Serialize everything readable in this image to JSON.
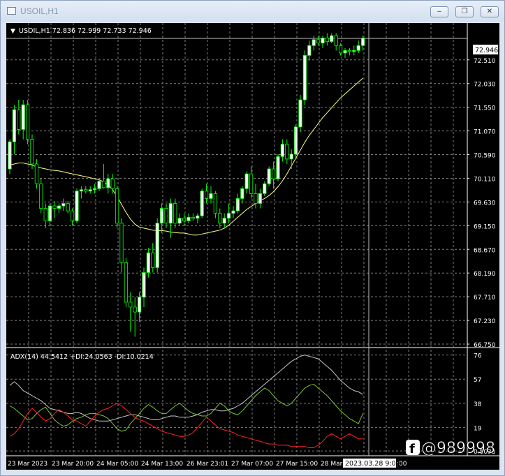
{
  "window": {
    "title": "USOIL,H1",
    "minimize_glyph": "‒",
    "restore_glyph": "❐",
    "close_glyph": "✕"
  },
  "chart_header": {
    "marker": "▼",
    "text": "USOIL,H1  72.836 72.999 72.733 72.946"
  },
  "indicator_header": {
    "text": "ADX(14) 44.5412 +DI:24.0563 -DI:10.0214"
  },
  "current_price": "72.946",
  "time_marker": "2023.03.28 9:00",
  "watermark": "@989998",
  "colors": {
    "background": "#000000",
    "grid": "#7f7f7f",
    "bull_candle": "#ffffff",
    "bear_candle": "#000000",
    "wick": "#00ff00",
    "moving_average": "#ffff80",
    "adx_line": "#c8c8c8",
    "plus_di": "#7cc832",
    "minus_di": "#ff2020",
    "axis_text": "#ffffff"
  },
  "chart_data": [
    {
      "type": "candlestick",
      "y_ticks": [
        "72.510",
        "72.030",
        "71.550",
        "71.070",
        "70.590",
        "70.110",
        "69.630",
        "69.150",
        "68.670",
        "68.190",
        "67.710",
        "67.230",
        "66.750"
      ],
      "x_ticks": [
        "23 Mar 2023",
        "23 Mar 20:00",
        "24 Mar 05:00",
        "24 Mar 13:00",
        "26 Mar 23:01",
        "27 Mar 07:00",
        "27 Mar 15:00",
        "28 Mar",
        "2023.03.28 9:00"
      ],
      "ylim": [
        66.75,
        73.2
      ],
      "candles": [
        {
          "o": 70.3,
          "h": 70.9,
          "l": 70.2,
          "c": 70.85
        },
        {
          "o": 70.85,
          "h": 71.6,
          "l": 70.6,
          "c": 71.5
        },
        {
          "o": 71.5,
          "h": 71.7,
          "l": 71.0,
          "c": 71.1
        },
        {
          "o": 71.1,
          "h": 71.7,
          "l": 70.9,
          "c": 71.6
        },
        {
          "o": 71.6,
          "h": 71.7,
          "l": 70.8,
          "c": 70.9
        },
        {
          "o": 70.9,
          "h": 71.0,
          "l": 70.3,
          "c": 70.4
        },
        {
          "o": 70.4,
          "h": 70.5,
          "l": 69.9,
          "c": 70.0
        },
        {
          "o": 70.0,
          "h": 70.1,
          "l": 69.4,
          "c": 69.5
        },
        {
          "o": 69.5,
          "h": 69.6,
          "l": 69.1,
          "c": 69.25
        },
        {
          "o": 69.25,
          "h": 69.6,
          "l": 69.15,
          "c": 69.55
        },
        {
          "o": 69.55,
          "h": 69.65,
          "l": 69.3,
          "c": 69.5
        },
        {
          "o": 69.5,
          "h": 69.6,
          "l": 69.4,
          "c": 69.55
        },
        {
          "o": 69.55,
          "h": 69.7,
          "l": 69.45,
          "c": 69.6
        },
        {
          "o": 69.6,
          "h": 69.65,
          "l": 69.4,
          "c": 69.45
        },
        {
          "o": 69.45,
          "h": 69.5,
          "l": 69.15,
          "c": 69.25
        },
        {
          "o": 69.25,
          "h": 69.9,
          "l": 69.2,
          "c": 69.85
        },
        {
          "o": 69.85,
          "h": 69.95,
          "l": 69.7,
          "c": 69.88
        },
        {
          "o": 69.88,
          "h": 69.95,
          "l": 69.8,
          "c": 69.85
        },
        {
          "o": 69.85,
          "h": 69.95,
          "l": 69.8,
          "c": 69.88
        },
        {
          "o": 69.88,
          "h": 70.0,
          "l": 69.8,
          "c": 69.9
        },
        {
          "o": 69.9,
          "h": 70.1,
          "l": 69.85,
          "c": 70.05
        },
        {
          "o": 70.05,
          "h": 70.4,
          "l": 69.9,
          "c": 69.92
        },
        {
          "o": 69.92,
          "h": 70.2,
          "l": 69.8,
          "c": 70.1
        },
        {
          "o": 70.1,
          "h": 70.2,
          "l": 69.8,
          "c": 69.9
        },
        {
          "o": 69.9,
          "h": 69.95,
          "l": 69.1,
          "c": 69.2
        },
        {
          "o": 69.2,
          "h": 69.3,
          "l": 68.2,
          "c": 68.4
        },
        {
          "o": 68.4,
          "h": 68.5,
          "l": 67.5,
          "c": 67.6
        },
        {
          "o": 67.6,
          "h": 67.8,
          "l": 67.0,
          "c": 67.5
        },
        {
          "o": 67.5,
          "h": 67.7,
          "l": 66.9,
          "c": 67.4
        },
        {
          "o": 67.4,
          "h": 67.8,
          "l": 67.2,
          "c": 67.7
        },
        {
          "o": 67.7,
          "h": 68.3,
          "l": 67.5,
          "c": 68.2
        },
        {
          "o": 68.2,
          "h": 68.7,
          "l": 68.1,
          "c": 68.6
        },
        {
          "o": 68.6,
          "h": 68.8,
          "l": 68.2,
          "c": 68.3
        },
        {
          "o": 68.3,
          "h": 69.3,
          "l": 68.2,
          "c": 69.2
        },
        {
          "o": 69.2,
          "h": 69.6,
          "l": 69.0,
          "c": 69.5
        },
        {
          "o": 69.5,
          "h": 69.6,
          "l": 69.1,
          "c": 69.2
        },
        {
          "o": 69.2,
          "h": 69.7,
          "l": 68.9,
          "c": 69.6
        },
        {
          "o": 69.6,
          "h": 69.7,
          "l": 69.1,
          "c": 69.2
        },
        {
          "o": 69.2,
          "h": 69.4,
          "l": 69.15,
          "c": 69.3
        },
        {
          "o": 69.3,
          "h": 69.4,
          "l": 69.15,
          "c": 69.25
        },
        {
          "o": 69.25,
          "h": 69.4,
          "l": 69.2,
          "c": 69.32
        },
        {
          "o": 69.32,
          "h": 69.4,
          "l": 69.25,
          "c": 69.3
        },
        {
          "o": 69.3,
          "h": 69.4,
          "l": 69.2,
          "c": 69.35
        },
        {
          "o": 69.35,
          "h": 69.9,
          "l": 69.3,
          "c": 69.85
        },
        {
          "o": 69.85,
          "h": 70.0,
          "l": 69.6,
          "c": 69.7
        },
        {
          "o": 69.7,
          "h": 69.95,
          "l": 69.6,
          "c": 69.8
        },
        {
          "o": 69.8,
          "h": 69.85,
          "l": 69.3,
          "c": 69.4
        },
        {
          "o": 69.4,
          "h": 69.5,
          "l": 69.1,
          "c": 69.2
        },
        {
          "o": 69.2,
          "h": 69.4,
          "l": 69.1,
          "c": 69.3
        },
        {
          "o": 69.3,
          "h": 69.6,
          "l": 69.2,
          "c": 69.4
        },
        {
          "o": 69.4,
          "h": 69.55,
          "l": 69.3,
          "c": 69.45
        },
        {
          "o": 69.45,
          "h": 69.8,
          "l": 69.4,
          "c": 69.7
        },
        {
          "o": 69.7,
          "h": 69.95,
          "l": 69.6,
          "c": 69.9
        },
        {
          "o": 69.9,
          "h": 70.25,
          "l": 69.8,
          "c": 70.2
        },
        {
          "o": 70.2,
          "h": 70.35,
          "l": 69.7,
          "c": 69.8
        },
        {
          "o": 69.8,
          "h": 70.0,
          "l": 69.5,
          "c": 69.6
        },
        {
          "o": 69.6,
          "h": 69.9,
          "l": 69.5,
          "c": 69.8
        },
        {
          "o": 69.8,
          "h": 70.05,
          "l": 69.75,
          "c": 70.0
        },
        {
          "o": 70.0,
          "h": 70.35,
          "l": 69.95,
          "c": 70.3
        },
        {
          "o": 70.3,
          "h": 70.45,
          "l": 69.9,
          "c": 70.1
        },
        {
          "o": 70.1,
          "h": 70.6,
          "l": 70.05,
          "c": 70.55
        },
        {
          "o": 70.55,
          "h": 70.9,
          "l": 70.45,
          "c": 70.8
        },
        {
          "o": 70.8,
          "h": 70.9,
          "l": 70.4,
          "c": 70.5
        },
        {
          "o": 70.5,
          "h": 70.7,
          "l": 70.3,
          "c": 70.6
        },
        {
          "o": 70.6,
          "h": 71.2,
          "l": 70.5,
          "c": 71.15
        },
        {
          "o": 71.15,
          "h": 71.8,
          "l": 71.05,
          "c": 71.7
        },
        {
          "o": 71.7,
          "h": 72.7,
          "l": 71.6,
          "c": 72.6
        },
        {
          "o": 72.6,
          "h": 72.9,
          "l": 72.5,
          "c": 72.8
        },
        {
          "o": 72.8,
          "h": 73.0,
          "l": 72.7,
          "c": 72.92
        },
        {
          "o": 72.92,
          "h": 73.0,
          "l": 72.8,
          "c": 72.85
        },
        {
          "o": 72.85,
          "h": 73.0,
          "l": 72.75,
          "c": 72.95
        },
        {
          "o": 72.95,
          "h": 73.05,
          "l": 72.8,
          "c": 72.88
        },
        {
          "o": 72.88,
          "h": 73.05,
          "l": 72.85,
          "c": 73.0
        },
        {
          "o": 73.0,
          "h": 73.05,
          "l": 72.7,
          "c": 72.8
        },
        {
          "o": 72.8,
          "h": 72.85,
          "l": 72.6,
          "c": 72.65
        },
        {
          "o": 72.65,
          "h": 72.75,
          "l": 72.55,
          "c": 72.7
        },
        {
          "o": 72.7,
          "h": 72.75,
          "l": 72.6,
          "c": 72.68
        },
        {
          "o": 72.68,
          "h": 72.8,
          "l": 72.6,
          "c": 72.7
        },
        {
          "o": 72.7,
          "h": 72.9,
          "l": 72.65,
          "c": 72.8
        },
        {
          "o": 72.8,
          "h": 73.0,
          "l": 72.7,
          "c": 72.95
        }
      ],
      "moving_average": [
        70.38,
        70.4,
        70.42,
        70.42,
        70.4,
        70.38,
        70.34,
        70.32,
        70.3,
        70.28,
        70.27,
        70.26,
        70.24,
        70.22,
        70.2,
        70.18,
        70.16,
        70.14,
        70.12,
        70.1,
        70.08,
        70.04,
        69.98,
        69.88,
        69.74,
        69.58,
        69.42,
        69.28,
        69.18,
        69.12,
        69.1,
        69.08,
        69.06,
        69.05,
        69.05,
        69.04,
        69.02,
        69.01,
        69.0,
        69.0,
        68.98,
        68.96,
        68.96,
        68.98,
        69.0,
        69.02,
        69.04,
        69.06,
        69.1,
        69.16,
        69.24,
        69.32,
        69.4,
        69.48,
        69.54,
        69.6,
        69.66,
        69.7,
        69.76,
        69.84,
        69.94,
        70.06,
        70.2,
        70.36,
        70.52,
        70.68,
        70.84,
        70.98,
        71.1,
        71.22,
        71.34,
        71.44,
        71.54,
        71.64,
        71.74,
        71.82,
        71.9,
        71.98,
        72.06,
        72.14
      ]
    },
    {
      "type": "line",
      "title": "ADX(14) 44.5412 +DI:24.0563 -DI:10.0214",
      "y_ticks": [
        "76",
        "57",
        "38",
        "19",
        "0.5033"
      ],
      "ylim": [
        0,
        78
      ],
      "series": [
        {
          "name": "ADX",
          "values": [
            52,
            55,
            52,
            48,
            46,
            44,
            42,
            40,
            37,
            34,
            33,
            32,
            31,
            30,
            30,
            31,
            30,
            28,
            26,
            25,
            24,
            24,
            24,
            25,
            26,
            27,
            28,
            29,
            29,
            28,
            27,
            26,
            25,
            25,
            26,
            27,
            28,
            28,
            27,
            27,
            27,
            28,
            29,
            31,
            32,
            33,
            33,
            32,
            32,
            33,
            34,
            36,
            38,
            41,
            44,
            47,
            50,
            53,
            56,
            59,
            62,
            65,
            68,
            71,
            73,
            75,
            76,
            75,
            74,
            73,
            70,
            67,
            64,
            60,
            56,
            53,
            50,
            48,
            47,
            45
          ]
        },
        {
          "name": "+DI",
          "values": [
            36,
            34,
            31,
            28,
            25,
            26,
            30,
            33,
            35,
            30,
            25,
            22,
            20,
            21,
            24,
            26,
            27,
            29,
            30,
            30,
            29,
            28,
            26,
            22,
            18,
            16,
            17,
            22,
            26,
            30,
            34,
            37,
            35,
            32,
            30,
            30,
            33,
            36,
            38,
            35,
            32,
            30,
            29,
            28,
            28,
            30,
            34,
            38,
            36,
            32,
            30,
            29,
            32,
            36,
            40,
            44,
            47,
            50,
            48,
            44,
            40,
            38,
            36,
            38,
            42,
            46,
            50,
            52,
            53,
            50,
            47,
            44,
            40,
            36,
            32,
            29,
            26,
            24,
            22,
            30
          ]
        },
        {
          "name": "-DI",
          "values": [
            12,
            14,
            18,
            24,
            30,
            34,
            31,
            27,
            24,
            26,
            30,
            33,
            31,
            28,
            25,
            24,
            22,
            20,
            24,
            28,
            31,
            33,
            34,
            36,
            38,
            36,
            33,
            30,
            27,
            25,
            24,
            22,
            20,
            18,
            16,
            15,
            14,
            13,
            12,
            12,
            13,
            15,
            19,
            23,
            27,
            24,
            21,
            18,
            17,
            16,
            15,
            13,
            12,
            11,
            10,
            9,
            8,
            7,
            6,
            6,
            5,
            5,
            5,
            4,
            4,
            4,
            4,
            3,
            3,
            5,
            8,
            12,
            14,
            12,
            10,
            12,
            14,
            12,
            10,
            10
          ]
        }
      ]
    }
  ]
}
